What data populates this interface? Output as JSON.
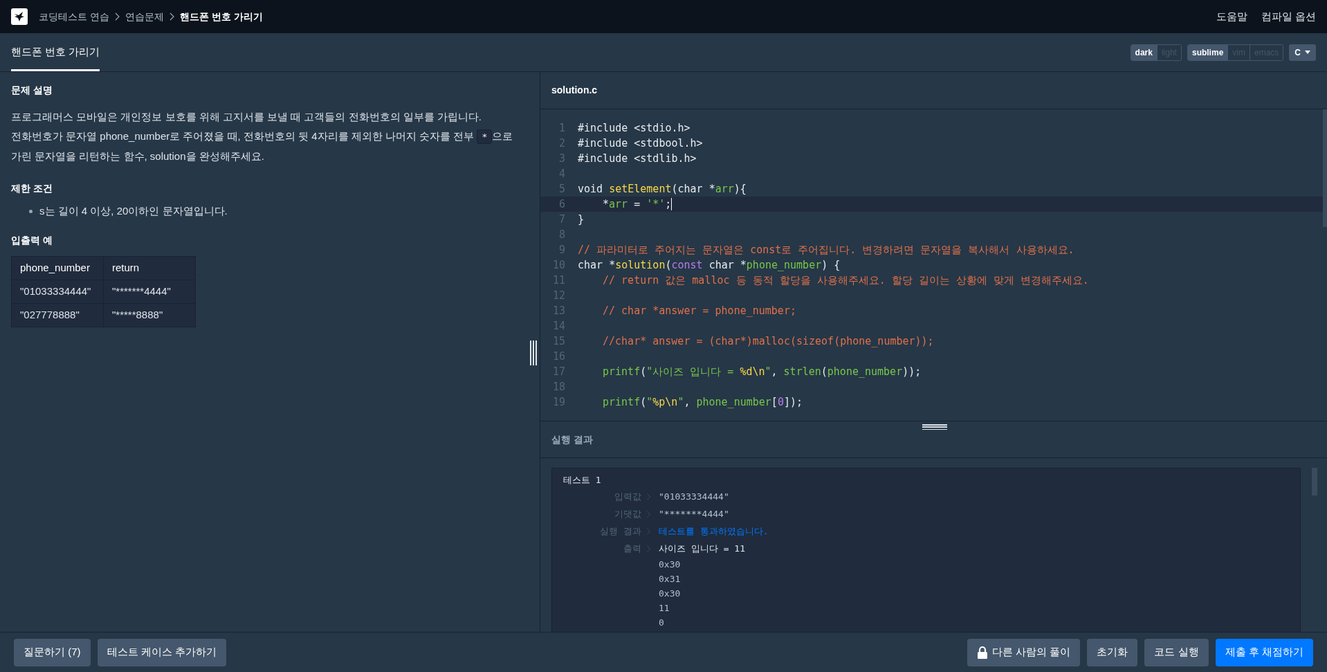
{
  "breadcrumbs": [
    {
      "label": "코딩테스트 연습",
      "current": false
    },
    {
      "label": "연습문제",
      "current": false
    },
    {
      "label": "핸드폰 번호 가리기",
      "current": true
    }
  ],
  "top_links": [
    "도움말",
    "컴파일 옵션"
  ],
  "tabs": [
    {
      "label": "핸드폰 번호 가리기",
      "selected": true
    }
  ],
  "toggles": [
    {
      "options": [
        {
          "label": "dark",
          "selected": true
        },
        {
          "label": "light",
          "selected": false
        }
      ]
    },
    {
      "options": [
        {
          "label": "sublime",
          "selected": true
        },
        {
          "label": "vim",
          "selected": false
        },
        {
          "label": "emacs",
          "selected": false
        }
      ]
    }
  ],
  "language": "C",
  "problem": {
    "heading": "문제 설명",
    "paragraphs": [
      {
        "before": "프로그래머스 모바일은 개인정보 보호를 위해 고지서를 보낼 때 고객들의 전화번호의 일부를 가립니다."
      },
      {
        "before": "전화번호가 문자열 phone_number로 주어졌을 때, 전화번호의 뒷 4자리를 제외한 나머지 숫자를 전부 ",
        "code": "*",
        "after": "으로 가린 문자열을 리턴하는 함수, solution을 완성해주세요."
      }
    ],
    "limits_heading": "제한 조건",
    "limits": [
      "s는 길이 4 이상, 20이하인 문자열입니다."
    ],
    "examples_heading": "입출력 예",
    "table": {
      "columns": [
        "phone_number",
        "return"
      ],
      "rows": [
        [
          "\"01033334444\"",
          "\"*******4444\""
        ],
        [
          "\"027778888\"",
          "\"*****8888\""
        ]
      ]
    }
  },
  "editor": {
    "filename": "solution.c",
    "lines": [
      {
        "no": "1",
        "active": false,
        "indented": false,
        "tokens": [
          {
            "t": "#include <stdio.h>",
            "kind": "plain"
          }
        ]
      },
      {
        "no": "2",
        "active": false,
        "indented": false,
        "tokens": [
          {
            "t": "#include <stdbool.h>",
            "kind": "plain"
          }
        ]
      },
      {
        "no": "3",
        "active": false,
        "indented": false,
        "tokens": [
          {
            "t": "#include <stdlib.h>",
            "kind": "plain"
          }
        ]
      },
      {
        "no": "4",
        "active": false
      },
      {
        "no": "5",
        "active": false,
        "indented": false,
        "tokens": [
          {
            "t": "void ",
            "kind": "plain"
          },
          {
            "t": "setElement",
            "kind": "func"
          },
          {
            "t": "(char *",
            "kind": "plain"
          },
          {
            "t": "arr",
            "kind": "var"
          },
          {
            "t": "){",
            "kind": "plain"
          }
        ]
      },
      {
        "no": "6",
        "active": true,
        "indented": true,
        "tokens": [
          {
            "t": "*",
            "kind": "plain"
          },
          {
            "t": "arr",
            "kind": "var"
          },
          {
            "t": " = ",
            "kind": "plain"
          },
          {
            "t": "'*'",
            "kind": "string"
          },
          {
            "t": ";",
            "kind": "plain"
          }
        ]
      },
      {
        "no": "7",
        "active": false,
        "indented": false,
        "tokens": [
          {
            "t": "}",
            "kind": "plain"
          }
        ]
      },
      {
        "no": "8",
        "active": false
      },
      {
        "no": "9",
        "active": false,
        "indented": false,
        "tokens": [
          {
            "t": "// 파라미터로 주어지는 문자열은 const로 주어집니다. 변경하려면 문자열을 복사해서 사용하세요.",
            "kind": "comment"
          }
        ]
      },
      {
        "no": "10",
        "active": false,
        "indented": false,
        "tokens": [
          {
            "t": "char *",
            "kind": "plain"
          },
          {
            "t": "solution",
            "kind": "func"
          },
          {
            "t": "(",
            "kind": "plain"
          },
          {
            "t": "const",
            "kind": "keyword"
          },
          {
            "t": " char *",
            "kind": "plain"
          },
          {
            "t": "phone_number",
            "kind": "var"
          },
          {
            "t": ") {",
            "kind": "plain"
          }
        ]
      },
      {
        "no": "11",
        "active": false,
        "indented": true,
        "tokens": [
          {
            "t": "// return 값은 malloc 등 동적 할당을 사용해주세요. 할당 길이는 상황에 맞게 변경해주세요.",
            "kind": "comment"
          }
        ]
      },
      {
        "no": "12",
        "active": false
      },
      {
        "no": "13",
        "active": false,
        "indented": true,
        "tokens": [
          {
            "t": "// char *answer = phone_number;",
            "kind": "comment"
          }
        ]
      },
      {
        "no": "14",
        "active": false
      },
      {
        "no": "15",
        "active": false,
        "indented": true,
        "tokens": [
          {
            "t": "//char* answer = (char*)malloc(sizeof(phone_number));",
            "kind": "comment"
          }
        ]
      },
      {
        "no": "16",
        "active": false
      },
      {
        "no": "17",
        "active": false,
        "indented": true,
        "tokens": [
          {
            "t": "printf",
            "kind": "var"
          },
          {
            "t": "(",
            "kind": "plain"
          },
          {
            "t": "\"사이즈 입니다 = ",
            "kind": "string"
          },
          {
            "t": "%d\\n",
            "kind": "func"
          },
          {
            "t": "\"",
            "kind": "string"
          },
          {
            "t": ", ",
            "kind": "plain"
          },
          {
            "t": "strlen",
            "kind": "var"
          },
          {
            "t": "(",
            "kind": "plain"
          },
          {
            "t": "phone_number",
            "kind": "var"
          },
          {
            "t": "));",
            "kind": "plain"
          }
        ]
      },
      {
        "no": "18",
        "active": false
      },
      {
        "no": "19",
        "active": false,
        "indented": true,
        "tokens": [
          {
            "t": "printf",
            "kind": "var"
          },
          {
            "t": "(",
            "kind": "plain"
          },
          {
            "t": "\"",
            "kind": "string"
          },
          {
            "t": "%p\\n",
            "kind": "func"
          },
          {
            "t": "\"",
            "kind": "string"
          },
          {
            "t": ", ",
            "kind": "plain"
          },
          {
            "t": "phone_number",
            "kind": "var"
          },
          {
            "t": "[",
            "kind": "plain"
          },
          {
            "t": "0",
            "kind": "keyword"
          },
          {
            "t": "]);",
            "kind": "plain"
          }
        ]
      }
    ]
  },
  "results": {
    "heading": "실행 결과",
    "tests": [
      {
        "title": "테스트 1",
        "rows": [
          {
            "label": "입력값",
            "kind": "value",
            "lines": [
              "\"01033334444\""
            ]
          },
          {
            "label": "기댓값",
            "kind": "value",
            "lines": [
              "\"*******4444\""
            ]
          },
          {
            "label": "실행 결과",
            "kind": "pass",
            "lines": [
              "테스트를 통과하였습니다."
            ]
          },
          {
            "label": "출력",
            "kind": "output",
            "lines": [
              "사이즈 입니다 = 11",
              "0x30",
              "0x31",
              "0x30",
              "11",
              "0"
            ]
          }
        ]
      }
    ]
  },
  "bottom_left": [
    {
      "label": "질문하기 (7)"
    },
    {
      "label": "테스트 케이스 추가하기"
    }
  ],
  "bottom_right": [
    {
      "label": "다른 사람의 풀이",
      "kind": "locked"
    },
    {
      "label": "초기화",
      "kind": "normal"
    },
    {
      "label": "코드 실행",
      "kind": "normal"
    },
    {
      "label": "제출 후 채점하기",
      "kind": "primary"
    }
  ]
}
